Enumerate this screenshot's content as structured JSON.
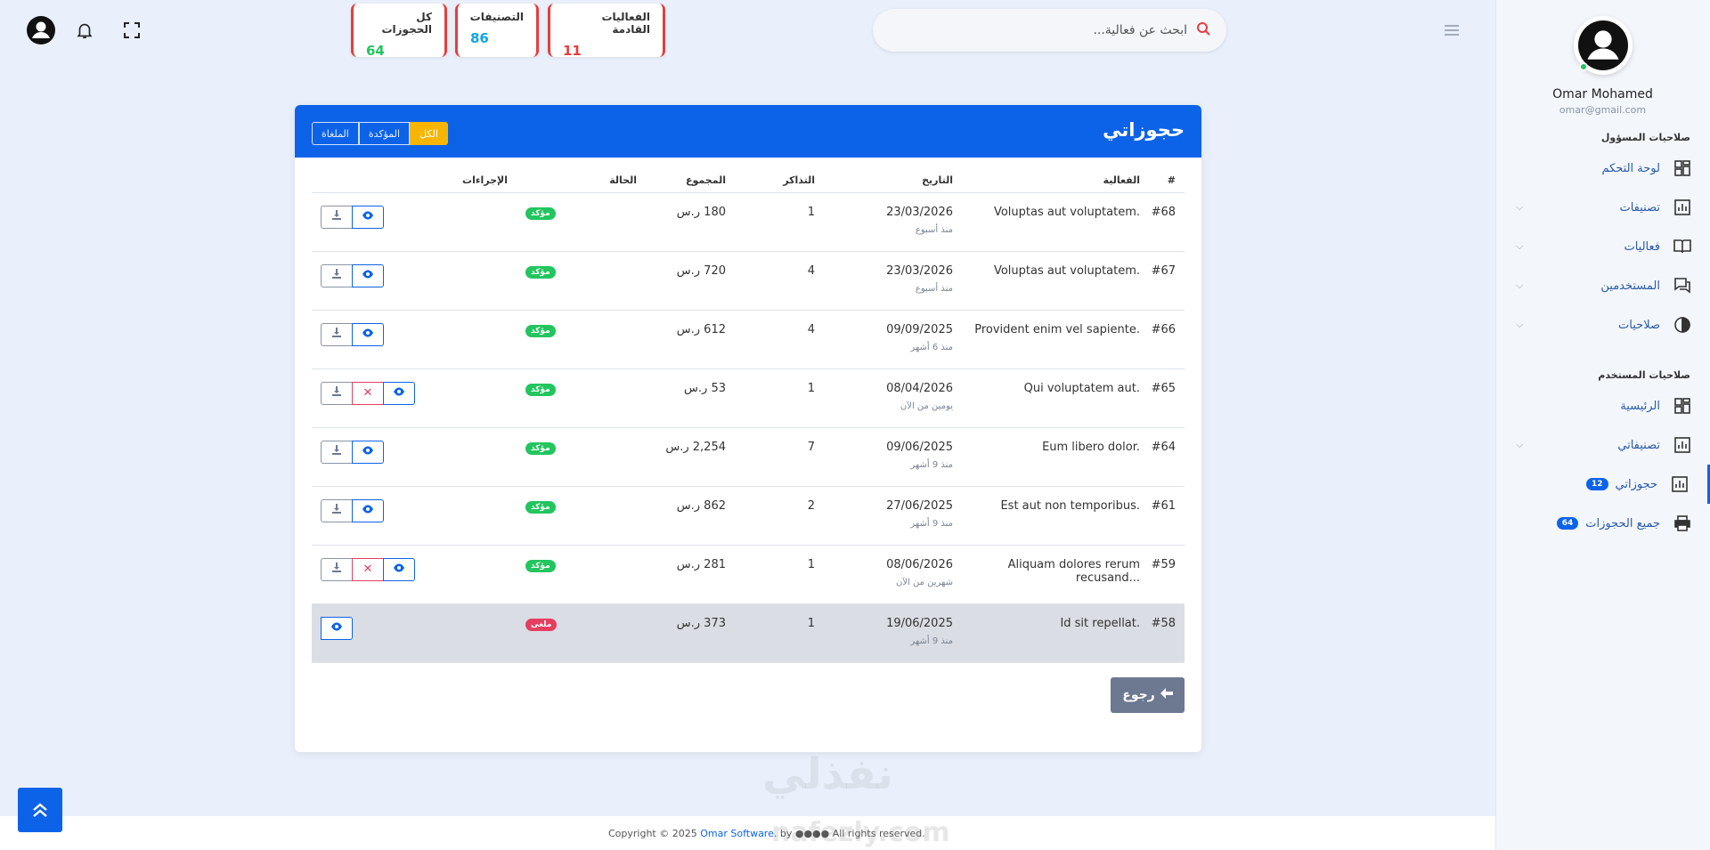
{
  "user": {
    "name": "Omar Mohamed",
    "email": "omar@gmail.com"
  },
  "sidebar": {
    "admin_section": "صلاحيات المسؤول",
    "admin_items": [
      {
        "label": "لوحة التحكم",
        "icon": "dashboard-icon"
      },
      {
        "label": "تصنيفات",
        "icon": "chart-icon"
      },
      {
        "label": "فعاليات",
        "icon": "book-icon"
      },
      {
        "label": "المستخدمين",
        "icon": "chat-icon"
      },
      {
        "label": "صلاحيات",
        "icon": "circle-half-icon"
      }
    ],
    "user_section": "صلاحيات المستخدم",
    "user_items": [
      {
        "label": "الرئيسية",
        "icon": "dashboard-icon"
      },
      {
        "label": "تصنيفاتي",
        "icon": "chart-icon"
      },
      {
        "label": "حجوزاتي",
        "icon": "chart-icon",
        "badge": "12",
        "active": true
      },
      {
        "label": "جميع الحجوزات",
        "icon": "printer-icon",
        "badge": "64"
      }
    ]
  },
  "stats": [
    {
      "label": "الفعاليات القادمة",
      "value": "11",
      "color": "#e53e3e"
    },
    {
      "label": "التصنيفات",
      "value": "86",
      "color": "#0ea5e9"
    },
    {
      "label": "كل الحجوزات",
      "value": "64",
      "color": "#22c55e"
    }
  ],
  "search": {
    "placeholder": "ابحث عن فعالية..."
  },
  "card": {
    "title": "حجوزاتي",
    "filters": [
      "الملغاة",
      "المؤكدة",
      "الكل"
    ],
    "columns": [
      "#",
      "الفعالية",
      "التاريخ",
      "التذاكر",
      "المجموع",
      "الحالة",
      "الإجراءات"
    ],
    "rows": [
      {
        "id": "#68",
        "event": "Voluptas aut voluptatem.",
        "date": "23/03/2026",
        "ago": "منذ أسبوع",
        "tickets": "1",
        "total": "180 ر.س",
        "status": "مؤكد",
        "cancellable": false
      },
      {
        "id": "#67",
        "event": "Voluptas aut voluptatem.",
        "date": "23/03/2026",
        "ago": "منذ أسبوع",
        "tickets": "4",
        "total": "720 ر.س",
        "status": "مؤكد",
        "cancellable": false
      },
      {
        "id": "#66",
        "event": "Provident enim vel sapiente.",
        "date": "09/09/2025",
        "ago": "منذ 6 أشهر",
        "tickets": "4",
        "total": "612 ر.س",
        "status": "مؤكد",
        "cancellable": false
      },
      {
        "id": "#65",
        "event": "Qui voluptatem aut.",
        "date": "08/04/2026",
        "ago": "يومين من الآن",
        "tickets": "1",
        "total": "53 ر.س",
        "status": "مؤكد",
        "cancellable": true
      },
      {
        "id": "#64",
        "event": "Eum libero dolor.",
        "date": "09/06/2025",
        "ago": "منذ 9 أشهر",
        "tickets": "7",
        "total": "2,254 ر.س",
        "status": "مؤكد",
        "cancellable": false
      },
      {
        "id": "#61",
        "event": "Est aut non temporibus.",
        "date": "27/06/2025",
        "ago": "منذ 9 أشهر",
        "tickets": "2",
        "total": "862 ر.س",
        "status": "مؤكد",
        "cancellable": false
      },
      {
        "id": "#59",
        "event": "Aliquam dolores rerum recusand...",
        "date": "08/06/2026",
        "ago": "شهرين من الآن",
        "tickets": "1",
        "total": "281 ر.س",
        "status": "مؤكد",
        "cancellable": true
      },
      {
        "id": "#58",
        "event": "Id sit repellat.",
        "date": "19/06/2025",
        "ago": "منذ 9 أشهر",
        "tickets": "1",
        "total": "373 ر.س",
        "status": "ملغى",
        "cancelled": true,
        "cancellable": false
      }
    ],
    "back_label": "رجوع"
  },
  "footer": {
    "prefix": "Copyright © 2025 ",
    "brand": "Omar Software",
    "suffix": ". by ●●●● All rights reserved."
  },
  "watermark": {
    "arabic": "نفذلي",
    "latin": "nafezly.com"
  },
  "colors": {
    "primary": "#0d63e8",
    "warning": "#f7b500",
    "success": "#22c55e",
    "danger": "#e53e5f"
  }
}
